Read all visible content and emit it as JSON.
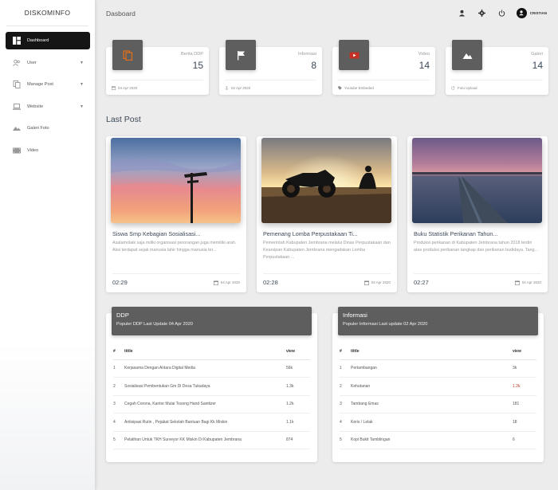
{
  "sidebar": {
    "brand": "DISKOMINFO",
    "items": [
      {
        "label": "Dashboard",
        "icon": "dashboard-icon"
      },
      {
        "label": "User",
        "icon": "users-icon"
      },
      {
        "label": "Manage Post",
        "icon": "copy-icon"
      },
      {
        "label": "Website",
        "icon": "laptop-icon"
      },
      {
        "label": "Galeri Foto",
        "icon": "landscape-icon"
      },
      {
        "label": "Video",
        "icon": "film-icon"
      }
    ]
  },
  "topbar": {
    "title": "Dasboard",
    "user_name": "CRISTIAN",
    "icons": [
      "person-icon",
      "gear-icon",
      "power-icon",
      "avatar"
    ]
  },
  "stats": [
    {
      "category": "Berita DDP",
      "value": "15",
      "footer": "04 Apr 2020",
      "icon": "copy-icon"
    },
    {
      "category": "Informasi",
      "value": "8",
      "footer": "02 Apr 2020",
      "icon": "flag-icon"
    },
    {
      "category": "Video",
      "value": "14",
      "footer": "Youtube Embeded",
      "icon": "youtube-icon"
    },
    {
      "category": "Galeri",
      "value": "14",
      "footer": "Foto Upload",
      "icon": "landscape-icon"
    }
  ],
  "last_post": {
    "title": "Last Post",
    "posts": [
      {
        "title": "Siswa Smp Kebagian Sosialisasi...",
        "desc": "Asalamolaik saja miliki organisasi perorangan juga memiliki arah. Aksi terdapat sejak manusia lahir hingga manusia ter...",
        "time": "02:29",
        "date": "04 Apr 2020"
      },
      {
        "title": "Pemenang Lomba Perpustakaan Ti...",
        "desc": "Pemerintah Kabupaten Jembrana melalui Dinas Perpustakaan dan Kearsipan Kabupaten Jembrana mengadakan Lomba Perpustakaan ...",
        "time": "02:28",
        "date": "04 Apr 2020"
      },
      {
        "title": "Buku Statistik Perikanan Tahun...",
        "desc": "Produksi perikanan di Kabupaten Jembrana tahun 2018 terdiri atas produksi perikanan tangkap dan perikanan budidaya. Tang...",
        "time": "02:27",
        "date": "04 Apr 2020"
      }
    ]
  },
  "ddp": {
    "title": "DDP",
    "subtitle": "Populer DDP Last Update 04 Apr 2020",
    "columns": [
      "#",
      "tittle",
      "view"
    ],
    "rows": [
      {
        "no": "1",
        "title": "Kerjasama Dengan Antara Digital Media",
        "view": "56k"
      },
      {
        "no": "2",
        "title": "Sosialisasi Pembentukan Gm Di Desa Tukadaya",
        "view": "1.3k"
      },
      {
        "no": "3",
        "title": "Cegah Corona, Kantor Mulai Tosong Hand Sanitizer",
        "view": "1.2k"
      },
      {
        "no": "4",
        "title": "Antisipasi Rutin , Pejabat Sekolah Bantuan Bagi Kk Miskin",
        "view": "1.1k"
      },
      {
        "no": "5",
        "title": "Pelatihan Untuk TKH Surveyor KK Miskin Di Kabupaten Jembrana",
        "view": "874"
      }
    ]
  },
  "informasi": {
    "title": "Informasi",
    "subtitle": "Populer Informasi Last update 02 Apr 2020",
    "columns": [
      "#",
      "tittle",
      "view"
    ],
    "rows": [
      {
        "no": "1",
        "title": "Pertambangan",
        "view": "3k"
      },
      {
        "no": "2",
        "title": "Kehutanan",
        "view": "1.2k"
      },
      {
        "no": "3",
        "title": "Tambang Emas",
        "view": "181"
      },
      {
        "no": "4",
        "title": "Keris / Lelak",
        "view": "18"
      },
      {
        "no": "5",
        "title": "Kopi Bukit Tamblingan",
        "view": "6"
      }
    ]
  },
  "colors": {
    "accent": "#151515",
    "header_bg": "#5e5e5e",
    "orange": "#e56f18",
    "red": "#c43024",
    "teal": "#26897c",
    "view_red": "#c43024"
  }
}
